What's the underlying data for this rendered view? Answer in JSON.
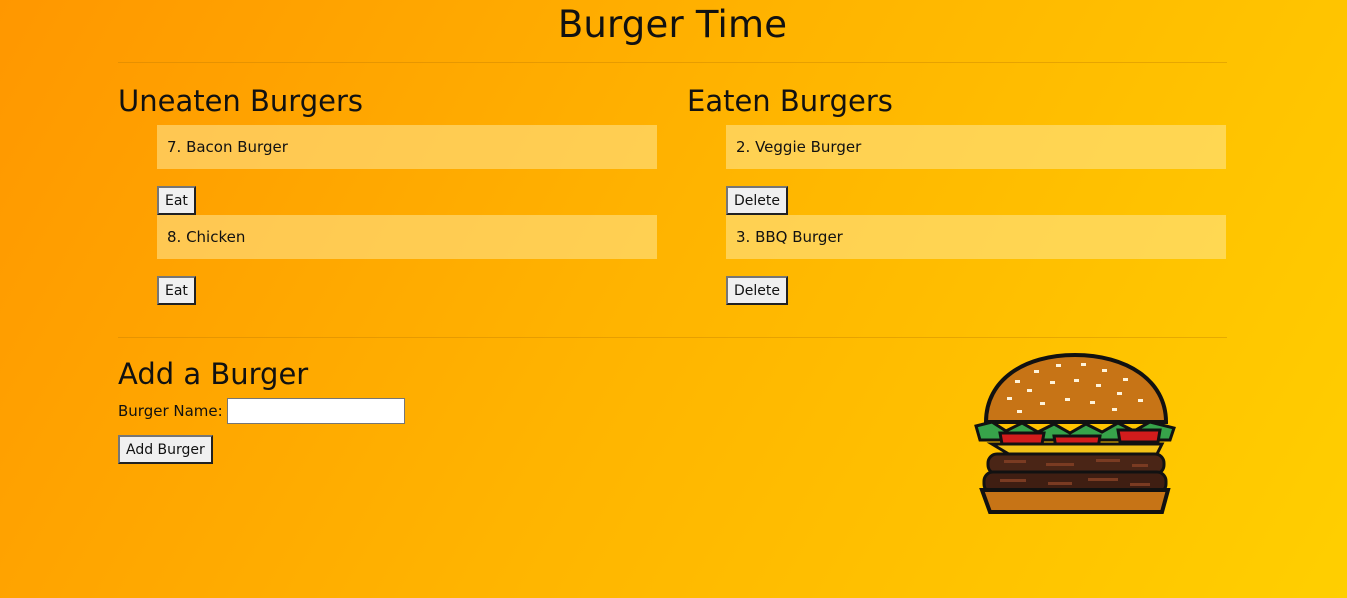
{
  "page": {
    "title": "Burger Time"
  },
  "uneaten": {
    "heading": "Uneaten Burgers",
    "items": [
      {
        "label": "7. Bacon Burger",
        "button": "Eat"
      },
      {
        "label": "8. Chicken",
        "button": "Eat"
      }
    ]
  },
  "eaten": {
    "heading": "Eaten Burgers",
    "items": [
      {
        "label": "2. Veggie Burger",
        "button": "Delete"
      },
      {
        "label": "3. BBQ Burger",
        "button": "Delete"
      }
    ]
  },
  "add_form": {
    "heading": "Add a Burger",
    "field_label": "Burger Name:",
    "field_value": "",
    "submit_label": "Add Burger"
  },
  "illustration": {
    "icon": "burger-icon"
  },
  "colors": {
    "background_start": "#ff9700",
    "background_end": "#ffcf00",
    "item_background": "#ffd466"
  }
}
